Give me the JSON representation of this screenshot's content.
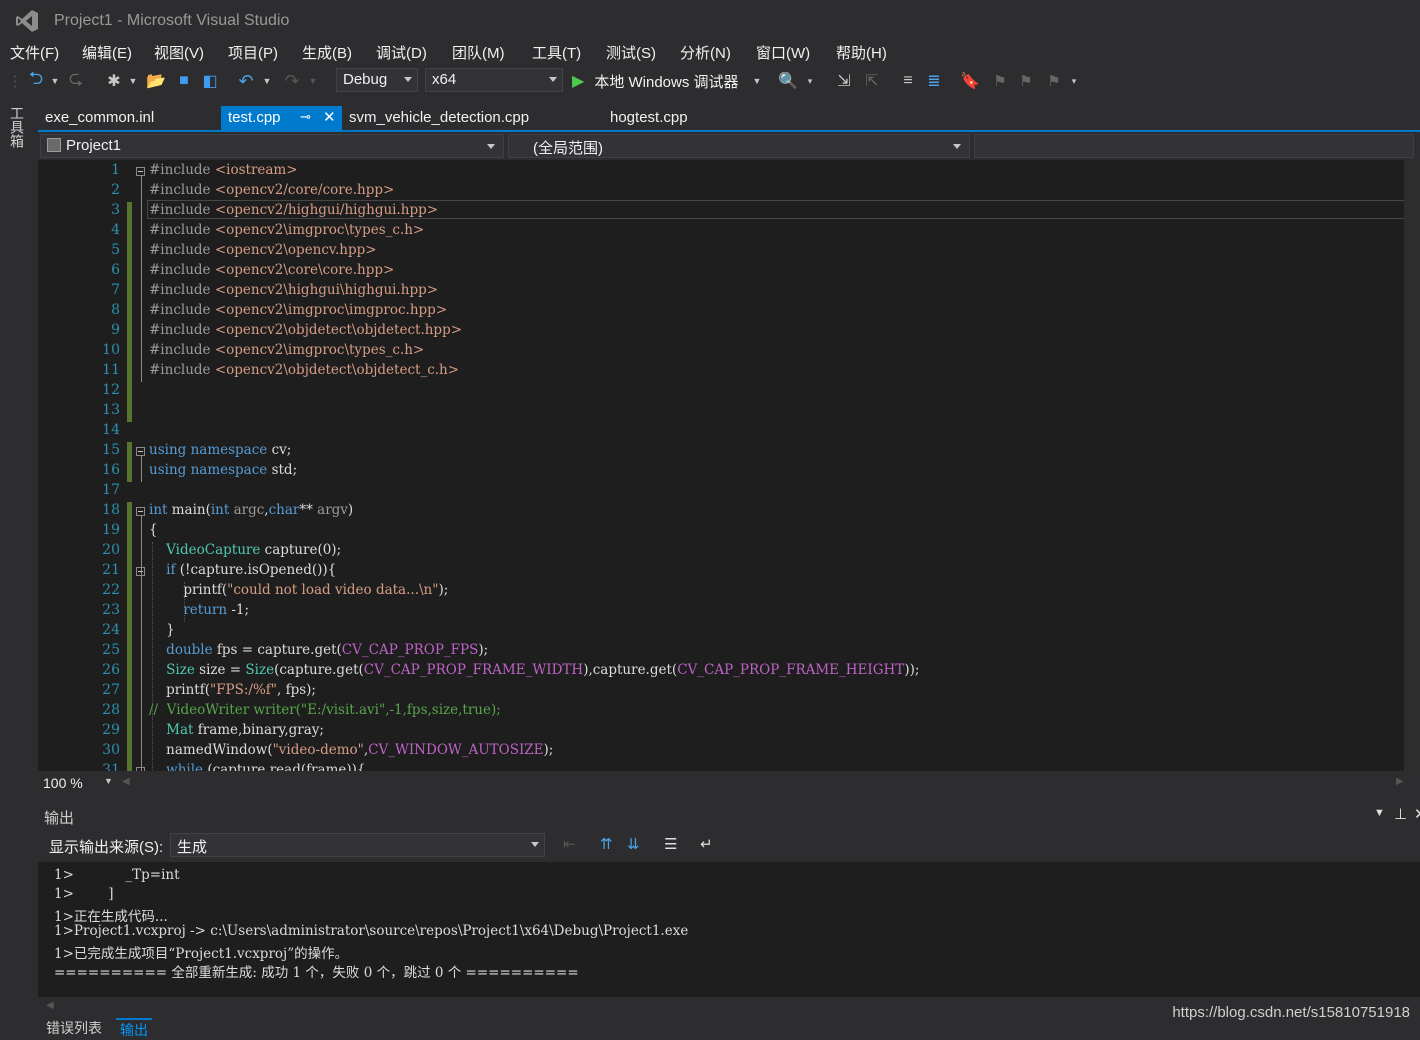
{
  "window": {
    "title": "Project1 - Microsoft Visual Studio"
  },
  "menu": [
    "文件(F)",
    "编辑(E)",
    "视图(V)",
    "项目(P)",
    "生成(B)",
    "调试(D)",
    "团队(M)",
    "工具(T)",
    "测试(S)",
    "分析(N)",
    "窗口(W)",
    "帮助(H)"
  ],
  "toolbar": {
    "config": "Debug",
    "platform": "x64",
    "debugger_label": "本地 Windows 调试器"
  },
  "toolbox_label": "工具箱",
  "tabs": [
    "exe_common.inl",
    "test.cpp",
    "svm_vehicle_detection.cpp",
    "hogtest.cpp"
  ],
  "active_tab": "test.cpp",
  "navbar": {
    "project": "Project1",
    "scope": "(全局范围)"
  },
  "code": {
    "line_numbers": [
      "1",
      "2",
      "3",
      "4",
      "5",
      "6",
      "7",
      "8",
      "9",
      "10",
      "11",
      "12",
      "13",
      "14",
      "15",
      "16",
      "17",
      "18",
      "19",
      "20",
      "21",
      "22",
      "23",
      "24",
      "25",
      "26",
      "27",
      "28",
      "29",
      "30",
      "31"
    ],
    "lines": [
      [
        {
          "c": "pp",
          "t": "#include "
        },
        {
          "c": "inc",
          "t": "<iostream>"
        }
      ],
      [
        {
          "c": "pp",
          "t": "#include "
        },
        {
          "c": "inc",
          "t": "<opencv2/core/core.hpp>"
        }
      ],
      [
        {
          "c": "pp",
          "t": "#include "
        },
        {
          "c": "inc",
          "t": "<opencv2/highgui/highgui.hpp>"
        }
      ],
      [
        {
          "c": "pp",
          "t": "#include "
        },
        {
          "c": "inc",
          "t": "<opencv2\\imgproc\\types_c.h>"
        }
      ],
      [
        {
          "c": "pp",
          "t": "#include "
        },
        {
          "c": "inc",
          "t": "<opencv2\\opencv.hpp>"
        }
      ],
      [
        {
          "c": "pp",
          "t": "#include "
        },
        {
          "c": "inc",
          "t": "<opencv2\\core\\core.hpp>"
        }
      ],
      [
        {
          "c": "pp",
          "t": "#include "
        },
        {
          "c": "inc",
          "t": "<opencv2\\highgui\\highgui.hpp>"
        }
      ],
      [
        {
          "c": "pp",
          "t": "#include "
        },
        {
          "c": "inc",
          "t": "<opencv2\\imgproc\\imgproc.hpp>"
        }
      ],
      [
        {
          "c": "pp",
          "t": "#include "
        },
        {
          "c": "inc",
          "t": "<opencv2\\objdetect\\objdetect.hpp>"
        }
      ],
      [
        {
          "c": "pp",
          "t": "#include "
        },
        {
          "c": "inc",
          "t": "<opencv2\\imgproc\\types_c.h>"
        }
      ],
      [
        {
          "c": "pp",
          "t": "#include "
        },
        {
          "c": "inc",
          "t": "<opencv2\\objdetect\\objdetect_c.h>"
        }
      ],
      [],
      [],
      [],
      [
        {
          "c": "kw",
          "t": "using"
        },
        {
          "c": "",
          "t": " "
        },
        {
          "c": "kw",
          "t": "namespace"
        },
        {
          "c": "",
          "t": " cv;"
        }
      ],
      [
        {
          "c": "kw",
          "t": "using"
        },
        {
          "c": "",
          "t": " "
        },
        {
          "c": "kw",
          "t": "namespace"
        },
        {
          "c": "",
          "t": " std;"
        }
      ],
      [],
      [
        {
          "c": "kw",
          "t": "int"
        },
        {
          "c": "",
          "t": " main("
        },
        {
          "c": "kw",
          "t": "int"
        },
        {
          "c": "pp",
          "t": " argc"
        },
        {
          "c": "",
          "t": ","
        },
        {
          "c": "kw",
          "t": "char"
        },
        {
          "c": "",
          "t": "**"
        },
        {
          "c": "pp",
          "t": " argv"
        },
        {
          "c": "",
          "t": ")"
        }
      ],
      [
        {
          "c": "",
          "t": "{"
        }
      ],
      [
        {
          "c": "",
          "t": "    "
        },
        {
          "c": "ty",
          "t": "VideoCapture"
        },
        {
          "c": "",
          "t": " capture(0);"
        }
      ],
      [
        {
          "c": "",
          "t": "    "
        },
        {
          "c": "kw",
          "t": "if"
        },
        {
          "c": "",
          "t": " (!capture.isOpened()){"
        }
      ],
      [
        {
          "c": "",
          "t": "        printf("
        },
        {
          "c": "str",
          "t": "\"could not load video data...\\n\""
        },
        {
          "c": "",
          "t": ");"
        }
      ],
      [
        {
          "c": "",
          "t": "        "
        },
        {
          "c": "kw",
          "t": "return"
        },
        {
          "c": "",
          "t": " -1;"
        }
      ],
      [
        {
          "c": "",
          "t": "    }"
        }
      ],
      [
        {
          "c": "",
          "t": "    "
        },
        {
          "c": "kw",
          "t": "double"
        },
        {
          "c": "",
          "t": " fps = capture.get("
        },
        {
          "c": "mac",
          "t": "CV_CAP_PROP_FPS"
        },
        {
          "c": "",
          "t": ");"
        }
      ],
      [
        {
          "c": "",
          "t": "    "
        },
        {
          "c": "ty",
          "t": "Size"
        },
        {
          "c": "",
          "t": " size = "
        },
        {
          "c": "ty",
          "t": "Size"
        },
        {
          "c": "",
          "t": "(capture.get("
        },
        {
          "c": "mac",
          "t": "CV_CAP_PROP_FRAME_WIDTH"
        },
        {
          "c": "",
          "t": "),capture.get("
        },
        {
          "c": "mac",
          "t": "CV_CAP_PROP_FRAME_HEIGHT"
        },
        {
          "c": "",
          "t": "));"
        }
      ],
      [
        {
          "c": "",
          "t": "    printf("
        },
        {
          "c": "str",
          "t": "\"FPS:/%f\""
        },
        {
          "c": "",
          "t": ", fps);"
        }
      ],
      [
        {
          "c": "cm",
          "t": "//  VideoWriter writer(\"E:/visit.avi\",-1,fps,size,true);"
        }
      ],
      [
        {
          "c": "",
          "t": "    "
        },
        {
          "c": "ty",
          "t": "Mat"
        },
        {
          "c": "",
          "t": " frame,binary,gray;"
        }
      ],
      [
        {
          "c": "",
          "t": "    namedWindow("
        },
        {
          "c": "str",
          "t": "\"video-demo\""
        },
        {
          "c": "",
          "t": ","
        },
        {
          "c": "mac",
          "t": "CV_WINDOW_AUTOSIZE"
        },
        {
          "c": "",
          "t": ");"
        }
      ],
      [
        {
          "c": "",
          "t": "    "
        },
        {
          "c": "kw",
          "t": "while"
        },
        {
          "c": "",
          "t": " (capture.read(frame)){"
        }
      ]
    ]
  },
  "zoom": "100 %",
  "output": {
    "title": "输出",
    "source_label": "显示输出来源(S):",
    "source_value": "生成",
    "lines": [
      "1>            _Tp=int",
      "1>        ]",
      "1>正在生成代码...",
      "1>Project1.vcxproj -> c:\\Users\\administrator\\source\\repos\\Project1\\x64\\Debug\\Project1.exe",
      "1>已完成生成项目“Project1.vcxproj”的操作。",
      "========== 全部重新生成: 成功 1 个，失败 0 个，跳过 0 个 =========="
    ]
  },
  "bottom_tabs": [
    "错误列表",
    "输出"
  ],
  "watermark": "https://blog.csdn.net/s15810751918",
  "colors": {
    "accent": "#007acc",
    "editor_bg": "#1e1e1e",
    "keyword": "#569cd6",
    "type": "#4ec9b0",
    "string": "#d69d85",
    "comment": "#57a64a",
    "macro": "#bd63c5",
    "line_number": "#2b91af"
  }
}
